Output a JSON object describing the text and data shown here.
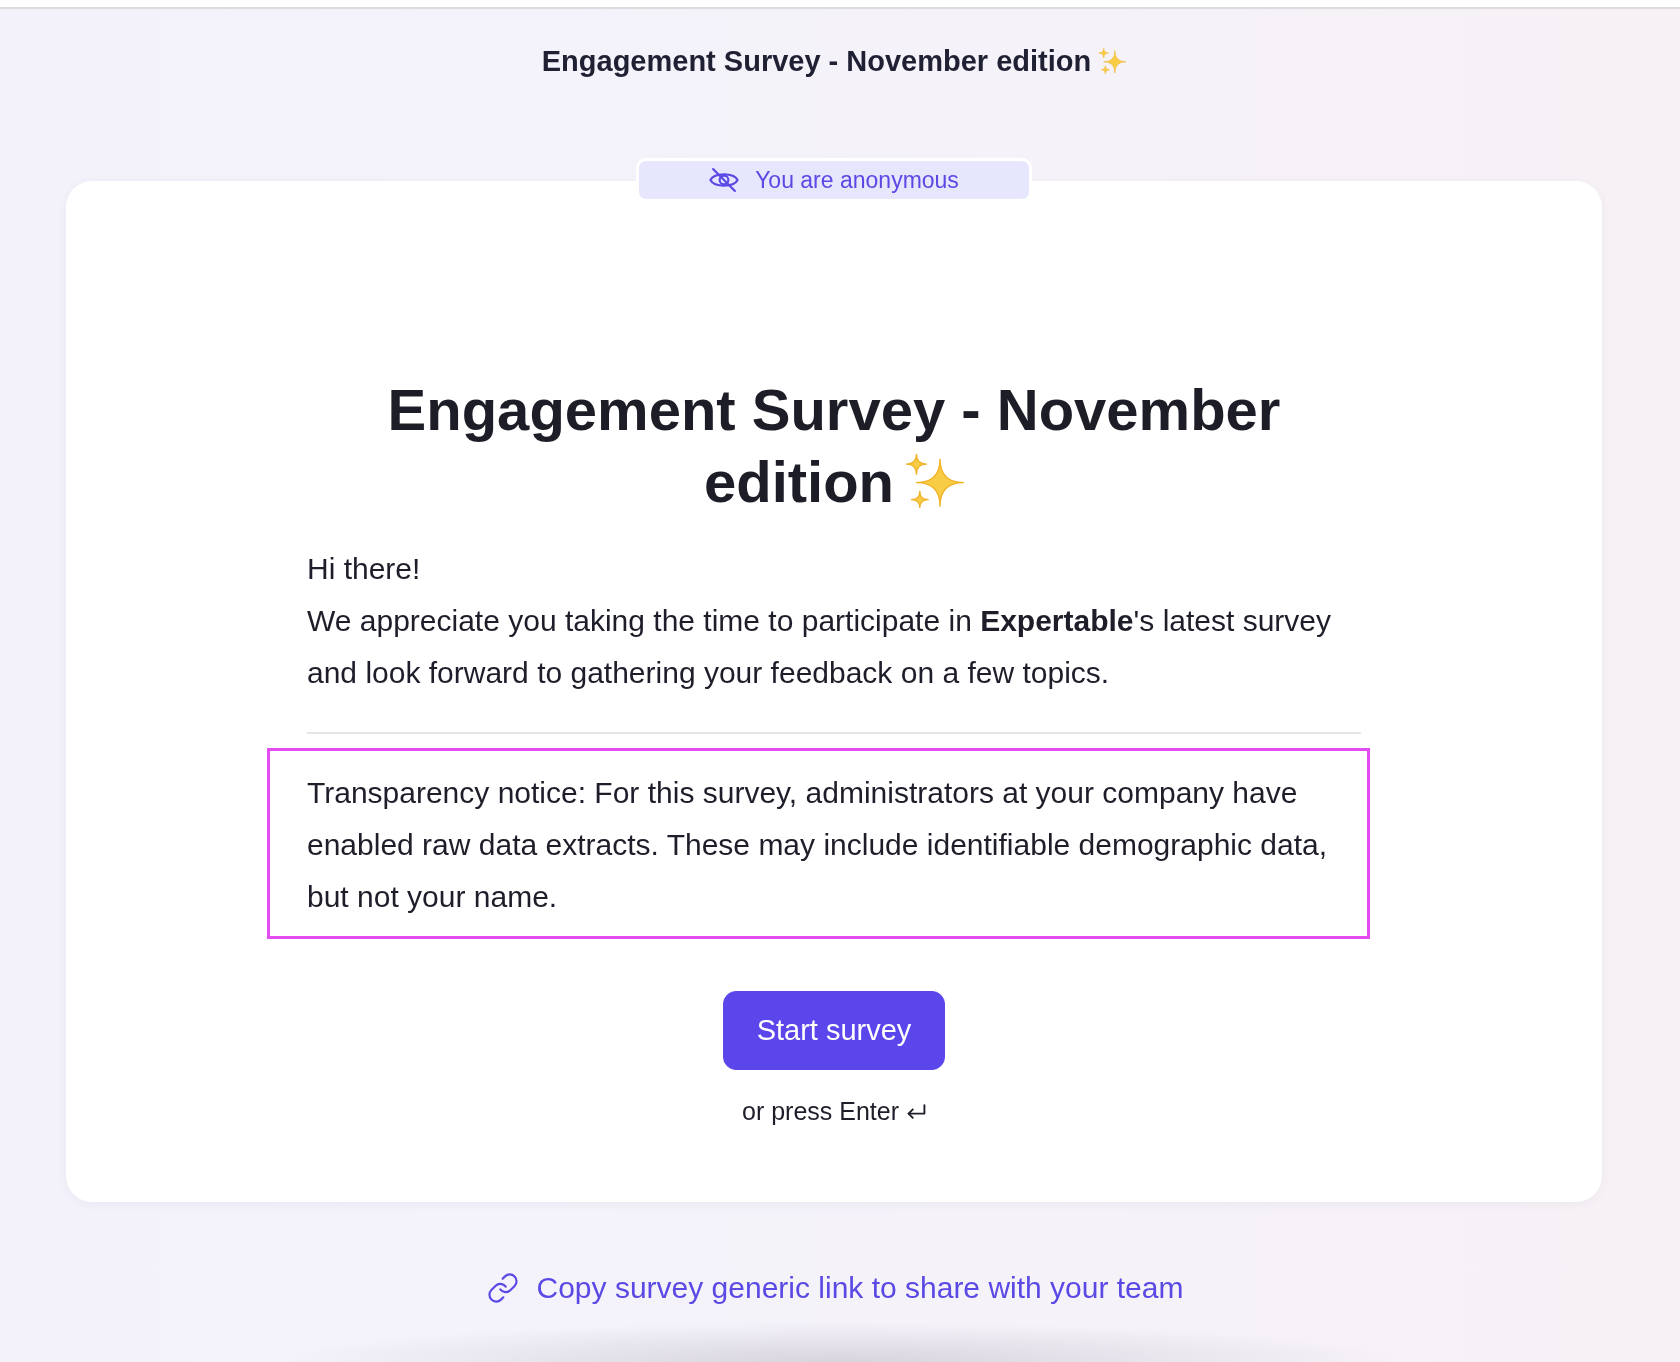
{
  "header": {
    "title": "Engagement Survey - November edition"
  },
  "badge": {
    "text": "You are anonymous"
  },
  "card": {
    "title_lines": [
      "Engagement Survey - November",
      "edition"
    ],
    "intro": [
      "Hi there!",
      "We appreciate you taking the time to participate in **Expertable**'s latest survey and look forward to gathering your feedback on a few topics."
    ],
    "notice": {
      "text": "Transparency notice: For this survey, administrators at your company have enabled raw data extracts. These may include identifiable demographic data, but not your name.",
      "highlighted": true
    },
    "button": {
      "label": "Start survey"
    },
    "hint": "or press Enter"
  },
  "share_link": {
    "label": "Copy survey generic link to share with your team"
  }
}
